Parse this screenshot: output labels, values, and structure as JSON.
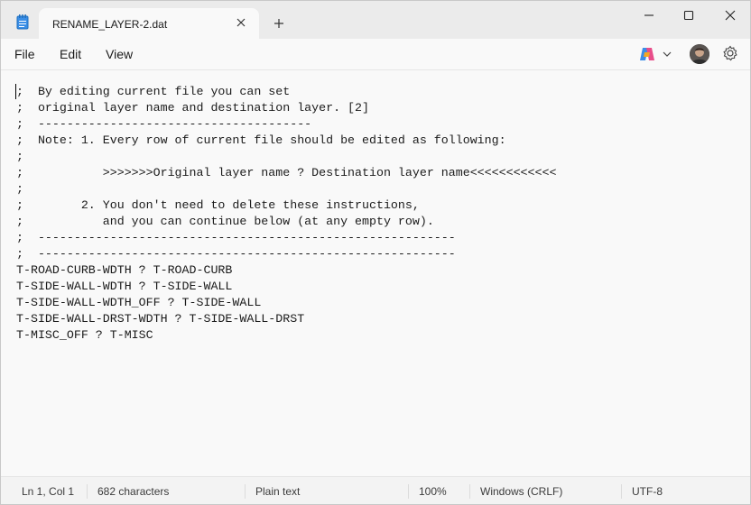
{
  "tab": {
    "title": "RENAME_LAYER-2.dat"
  },
  "menu": {
    "file": "File",
    "edit": "Edit",
    "view": "View"
  },
  "editor": {
    "lines": [
      ";  By editing current file you can set",
      ";  original layer name and destination layer. [2]",
      ";  --------------------------------------",
      ";  Note: 1. Every row of current file should be edited as following:",
      ";",
      ";           >>>>>>>Original layer name ? Destination layer name<<<<<<<<<<<<",
      ";",
      ";        2. You don't need to delete these instructions,",
      ";           and you can continue below (at any empty row).",
      ";  ----------------------------------------------------------",
      ";  ----------------------------------------------------------",
      "T-ROAD-CURB-WDTH ? T-ROAD-CURB",
      "T-SIDE-WALL-WDTH ? T-SIDE-WALL",
      "T-SIDE-WALL-WDTH_OFF ? T-SIDE-WALL",
      "T-SIDE-WALL-DRST-WDTH ? T-SIDE-WALL-DRST",
      "T-MISC_OFF ? T-MISC"
    ]
  },
  "status": {
    "position": "Ln 1, Col 1",
    "characters": "682 characters",
    "format": "Plain text",
    "zoom": "100%",
    "line_ending": "Windows (CRLF)",
    "encoding": "UTF-8"
  }
}
